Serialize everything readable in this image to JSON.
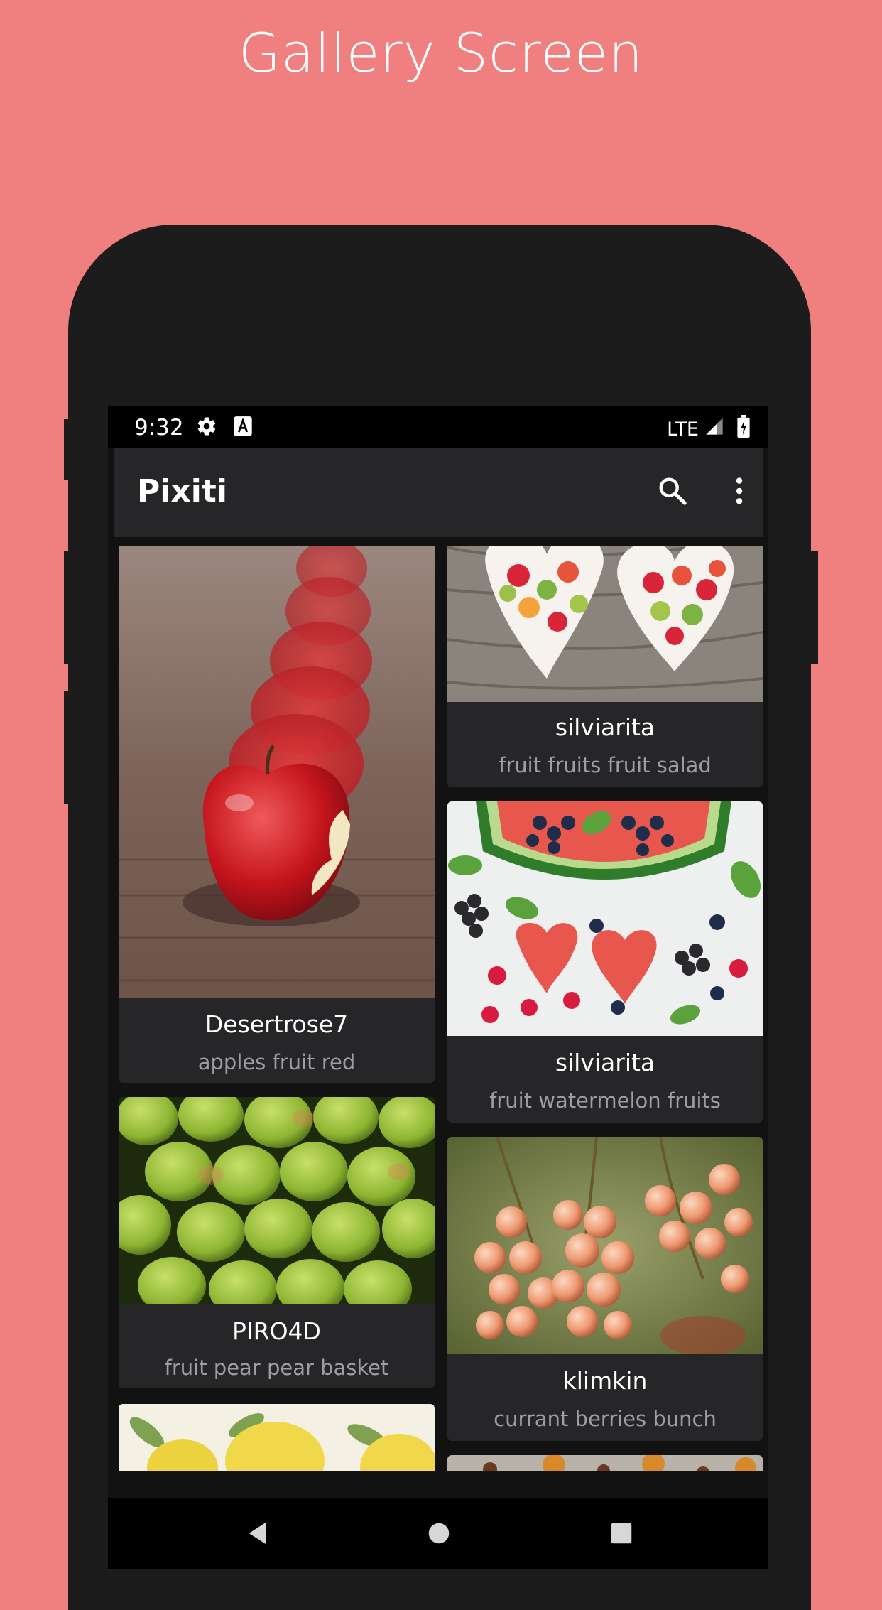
{
  "banner": {
    "title": "Gallery Screen"
  },
  "status_bar": {
    "time": "9:32",
    "network": "LTE"
  },
  "app_bar": {
    "title": "Pixiti"
  },
  "cards": [
    {
      "user": "Desertrose7",
      "tags": "apples fruit red"
    },
    {
      "user": "silviarita",
      "tags": "fruit fruits fruit salad"
    },
    {
      "user": "silviarita",
      "tags": "fruit watermelon fruits"
    },
    {
      "user": "PIRO4D",
      "tags": "fruit pear pear basket"
    },
    {
      "user": "klimkin",
      "tags": "currant berries bunch"
    }
  ],
  "icons": {
    "status_left": [
      "gear-icon",
      "keyboard-a-icon"
    ],
    "status_right": [
      "signal-icon",
      "battery-charging-icon"
    ],
    "app_bar": [
      "search-icon",
      "more-vert-icon"
    ],
    "nav": [
      "back-icon",
      "home-icon",
      "recents-icon"
    ]
  },
  "colors": {
    "background": "#f08080",
    "phone_body": "#1c1c1d",
    "screen_bg": "#121212",
    "card_bg": "#262628",
    "tag_text": "#9e9ea3"
  }
}
